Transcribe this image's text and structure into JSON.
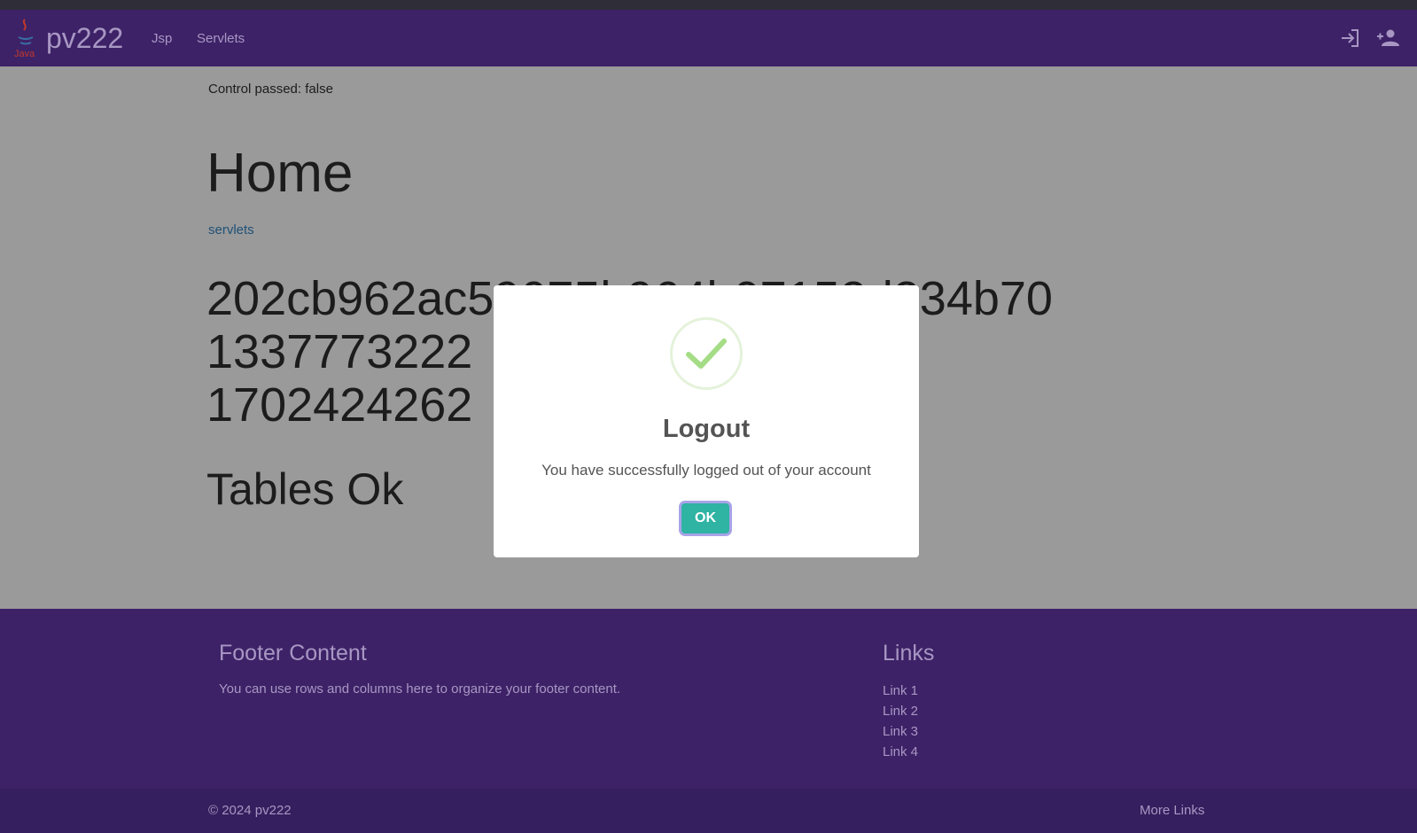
{
  "navbar": {
    "brand": "pv222",
    "logo_text": "Java",
    "links": [
      "Jsp",
      "Servlets"
    ],
    "right_icons": [
      "login-icon",
      "add-user-icon"
    ]
  },
  "main": {
    "control": "Control passed: false",
    "title": "Home",
    "servlets_link": "servlets",
    "values": [
      "202cb962ac59075b964b07152d234b70",
      "1337773222",
      "1702424262"
    ],
    "tables_status": "Tables Ok"
  },
  "footer": {
    "title": "Footer Content",
    "text": "You can use rows and columns here to organize your footer content.",
    "links_title": "Links",
    "links": [
      "Link 1",
      "Link 2",
      "Link 3",
      "Link 4"
    ],
    "copyright": "© 2024 pv222",
    "more_links": "More Links"
  },
  "modal": {
    "icon": "success-check-icon",
    "title": "Logout",
    "text": "You have successfully logged out of your account",
    "ok_label": "OK"
  },
  "colors": {
    "navbar": "#3d2267",
    "overlay": "#9a9a9a",
    "ok_button": "#2fb3a3",
    "check": "#a5dc86"
  }
}
